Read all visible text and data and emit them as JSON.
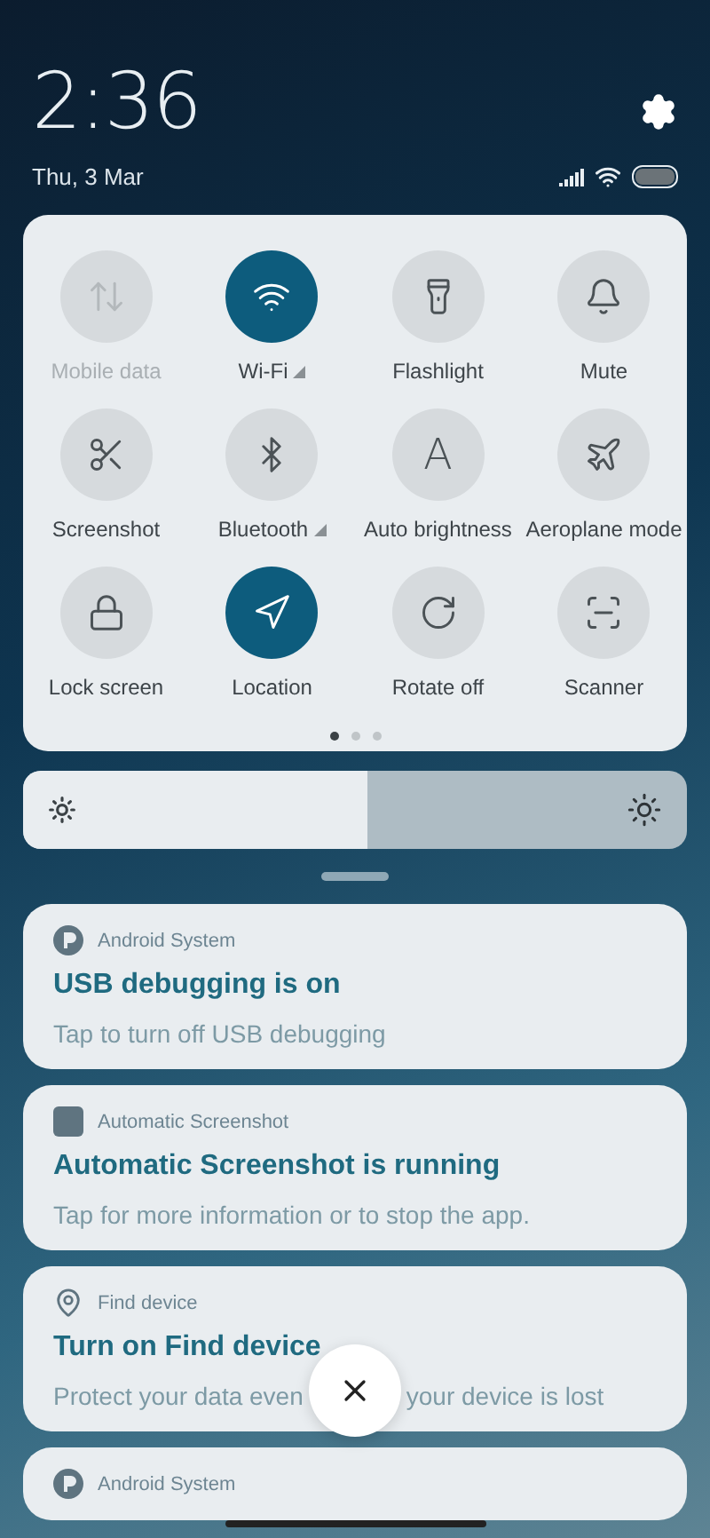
{
  "status": {
    "time": "2:36",
    "date": "Thu, 3 Mar"
  },
  "tiles": [
    {
      "label": "Mobile data",
      "on": false,
      "disabled": true,
      "expandable": false
    },
    {
      "label": "Wi-Fi",
      "on": true,
      "disabled": false,
      "expandable": true
    },
    {
      "label": "Flashlight",
      "on": false,
      "disabled": false,
      "expandable": false
    },
    {
      "label": "Mute",
      "on": false,
      "disabled": false,
      "expandable": false
    },
    {
      "label": "Screenshot",
      "on": false,
      "disabled": false,
      "expandable": false
    },
    {
      "label": "Bluetooth",
      "on": false,
      "disabled": false,
      "expandable": true
    },
    {
      "label": "Auto brightness",
      "on": false,
      "disabled": false,
      "expandable": false,
      "glyph": "A"
    },
    {
      "label": "Aeroplane mode",
      "on": false,
      "disabled": false,
      "expandable": false
    },
    {
      "label": "Lock screen",
      "on": false,
      "disabled": false,
      "expandable": false
    },
    {
      "label": "Location",
      "on": true,
      "disabled": false,
      "expandable": false
    },
    {
      "label": "Rotate off",
      "on": false,
      "disabled": false,
      "expandable": false
    },
    {
      "label": "Scanner",
      "on": false,
      "disabled": false,
      "expandable": false
    }
  ],
  "pages": [
    {
      "selected": true
    },
    {
      "selected": false
    },
    {
      "selected": false
    }
  ],
  "brightness": {
    "level": 0.52
  },
  "notifications": [
    {
      "app": "Android System",
      "title": "USB debugging is on",
      "body": "Tap to turn off USB debugging"
    },
    {
      "app": "Automatic Screenshot",
      "title": "Automatic Screenshot is running",
      "body": "Tap for more information or to stop the app."
    },
    {
      "app": "Find device",
      "title": "Turn on Find device",
      "body": "Protect your data even",
      "body_after": "your device is lost"
    },
    {
      "app": "Android System"
    }
  ]
}
